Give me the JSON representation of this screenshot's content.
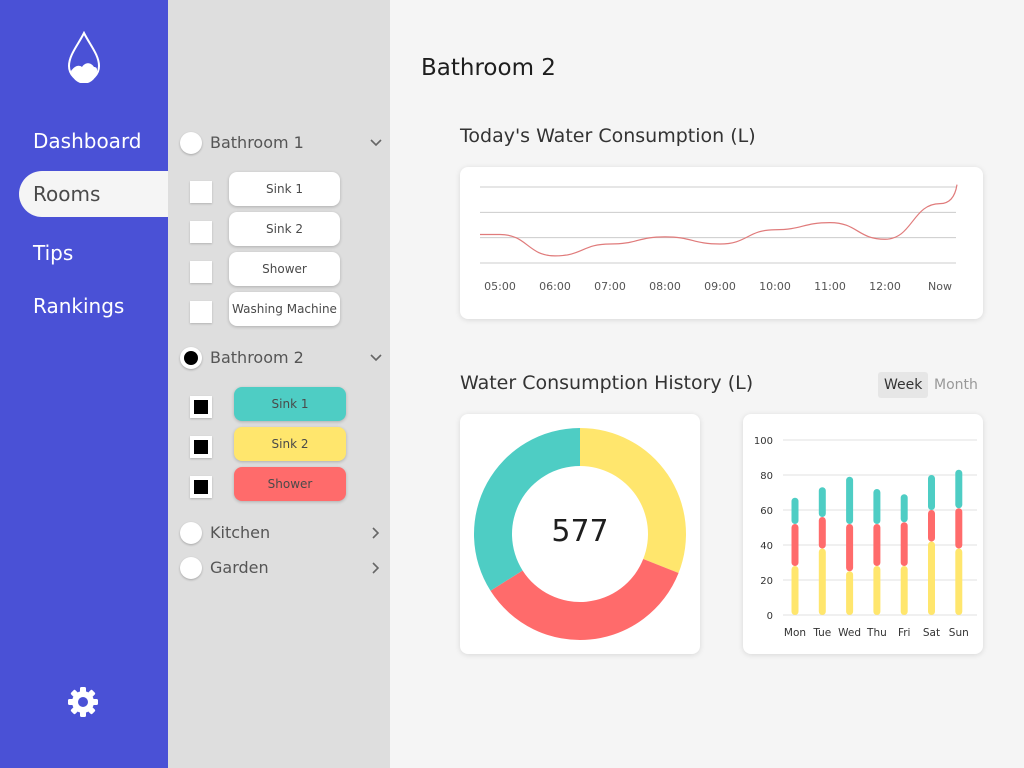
{
  "sidebar": {
    "nav": [
      {
        "label": "Dashboard",
        "active": false
      },
      {
        "label": "Rooms",
        "active": true
      },
      {
        "label": "Tips",
        "active": false
      },
      {
        "label": "Rankings",
        "active": false
      }
    ],
    "logo_icon": "water-drop-icon",
    "settings_icon": "gear-icon"
  },
  "rooms": [
    {
      "label": "Bathroom 1",
      "selected": false,
      "expanded": true,
      "devices": [
        {
          "label": "Sink 1",
          "checked": false
        },
        {
          "label": "Sink 2",
          "checked": false
        },
        {
          "label": "Shower",
          "checked": false
        },
        {
          "label": "Washing Machine",
          "checked": false
        }
      ]
    },
    {
      "label": "Bathroom 2",
      "selected": true,
      "expanded": true,
      "devices": [
        {
          "label": "Sink 1",
          "checked": true,
          "color": "#4ecdc4"
        },
        {
          "label": "Sink 2",
          "checked": true,
          "color": "#ffe66d"
        },
        {
          "label": "Shower",
          "checked": true,
          "color": "#ff6b6b"
        }
      ]
    },
    {
      "label": "Kitchen",
      "selected": false,
      "expanded": false
    },
    {
      "label": "Garden",
      "selected": false,
      "expanded": false
    }
  ],
  "main": {
    "title": "Bathroom 2",
    "today_title": "Today's Water Consumption (L)",
    "history_title": "Water Consumption History (L)",
    "toggle": {
      "week": "Week",
      "month": "Month",
      "selected": "Week"
    }
  },
  "colors": {
    "sink1": "#4ecdc4",
    "sink2": "#ffe66d",
    "shower": "#ff6b6b",
    "accent": "#4a51d6"
  },
  "chart_data": [
    {
      "type": "line",
      "title": "Today's Water Consumption (L)",
      "x": [
        "05:00",
        "06:00",
        "07:00",
        "08:00",
        "09:00",
        "10:00",
        "11:00",
        "12:00",
        "Now"
      ],
      "series": [
        {
          "values": [
            12,
            3,
            8,
            11,
            8,
            14,
            17,
            10,
            25
          ],
          "color": "#e07b7b"
        }
      ],
      "ylim": [
        0,
        32
      ],
      "grid": true
    },
    {
      "type": "pie",
      "donut": true,
      "center_label": "577",
      "slices": [
        {
          "label": "Sink 2",
          "value": 0.31,
          "color": "#ffe66d"
        },
        {
          "label": "Shower",
          "value": 0.35,
          "color": "#ff6b6b"
        },
        {
          "label": "Sink 1",
          "value": 0.34,
          "color": "#4ecdc4"
        }
      ]
    },
    {
      "type": "bar",
      "stacked": true,
      "categories": [
        "Mon",
        "Tue",
        "Wed",
        "Thu",
        "Fri",
        "Sat",
        "Sun"
      ],
      "series": [
        {
          "values": [
            28,
            38,
            25,
            28,
            28,
            42,
            38
          ],
          "color": "#ffe66d"
        },
        {
          "values": [
            24,
            18,
            27,
            24,
            25,
            18,
            23
          ],
          "color": "#ff6b6b"
        },
        {
          "values": [
            15,
            17,
            27,
            20,
            16,
            20,
            22
          ],
          "color": "#4ecdc4"
        }
      ],
      "ylim": [
        0,
        100
      ],
      "yticks": [
        "0",
        "20",
        "40",
        "60",
        "80",
        "100"
      ],
      "grid": true
    }
  ]
}
